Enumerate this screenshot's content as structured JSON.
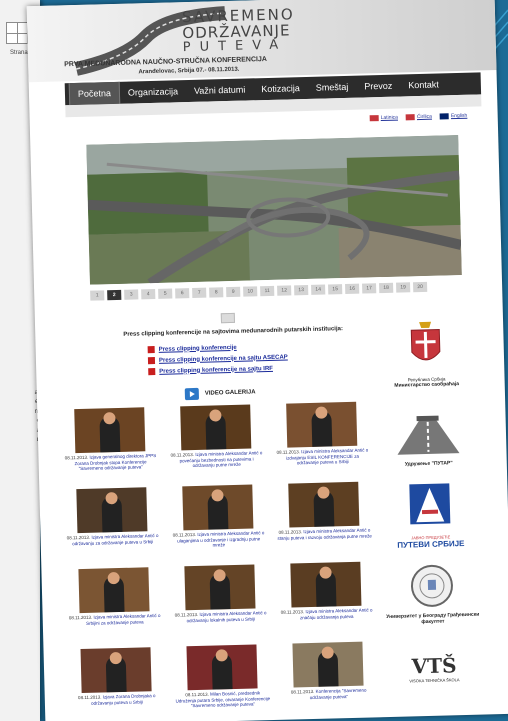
{
  "app": {
    "back_doc_label": "Strana",
    "back_doc_text_lines": [
      "a",
      "i",
      "-",
      "-",
      "g",
      "g",
      "i",
      "a-",
      "e,",
      "n-",
      "e",
      "a",
      "u"
    ]
  },
  "header": {
    "logo_line1": "SAVREMENO",
    "logo_line2": "ODRŽAVANJE",
    "logo_line3": "PUTEVA",
    "conference_title": "PRVA MEĐUNARODNA NAUČNO-STRUČNA KONFERENCIJA",
    "conference_sub": "Aranđelovac, Srbija 07.- 08.11.2013."
  },
  "nav": {
    "items": [
      {
        "label": "Početna",
        "active": true
      },
      {
        "label": "Organizacija",
        "active": false
      },
      {
        "label": "Važni datumi",
        "active": false
      },
      {
        "label": "Kotizacija",
        "active": false
      },
      {
        "label": "Smeštaj",
        "active": false
      },
      {
        "label": "Prevoz",
        "active": false
      },
      {
        "label": "Kontakt",
        "active": false
      }
    ]
  },
  "languages": [
    {
      "label": "Latinica",
      "flag_color": "#c6363c"
    },
    {
      "label": "Ćirilica",
      "flag_color": "#c6363c"
    },
    {
      "label": "English",
      "flag_color": "#012169"
    }
  ],
  "pager": {
    "pages": [
      "1",
      "2",
      "3",
      "4",
      "5",
      "6",
      "7",
      "8",
      "9",
      "10",
      "11",
      "12",
      "13",
      "14",
      "15",
      "16",
      "17",
      "18",
      "19",
      "20"
    ],
    "active_index": 1
  },
  "press": {
    "heading": "Press clipping konferencije na sajtovima medunarodnih putarskih institucija:",
    "items": [
      "Press clipping konferencije",
      "Press clipping konferencije na sajtu ASECAP",
      "Press clipping konferencije na sajtu IRF"
    ]
  },
  "video_gallery": "VIDEO GALERIJA",
  "thumbs": [
    {
      "date": "08.11.2013.",
      "caption": "Izjava generalnog direktora JPPS Zorana Drobnjak stopa Konferencije \"Savremeno održavanje puteva\""
    },
    {
      "date": "08.11.2013.",
      "caption": "Izjava ministra Aleksandar Antić o povećanju bezbednosti na putevima i održavanju putne mreže"
    },
    {
      "date": "08.11.2013.",
      "caption": "Izjava ministra Aleksandar Antić o izdvajanju ESIL KONFERENCIJE za održavanje puteva u Srbiji"
    },
    {
      "date": "08.11.2013.",
      "caption": "Izjava ministra Aleksandar Antić o održavanju za održavanje puteva u Srbiji"
    },
    {
      "date": "08.11.2013.",
      "caption": "Izjava ministra Aleksandar Antić o ulaganjima u održavanje i izgradnju putne mreže"
    },
    {
      "date": "08.11.2013.",
      "caption": "Izjava ministra Aleksandar Antić o stanju puteva i razvoju održavanja putne mreže"
    },
    {
      "date": "08.11.2013.",
      "caption": "Izjava ministra Aleksandar Antić o Srbijini za održavanje puteva"
    },
    {
      "date": "08.11.2013.",
      "caption": "Izjava ministra Aleksandar Antić o održavanju lokalnih puteva u Srbiji"
    },
    {
      "date": "08.11.2013.",
      "caption": "Izjava ministra Aleksandar Antić o značaju održavanja puteva"
    },
    {
      "date": "08.11.2013.",
      "caption": "Izjava Zorana Drobnjaka o održavanju puteva u Srbiji"
    },
    {
      "date": "08.11.2013.",
      "caption": "Milan Bosnić, predsednik Udruženja putara Srbije, otvaranje Konferencije \"Savremeno održavanje puteva\""
    },
    {
      "date": "08.11.2013.",
      "caption": "Konferencija \"Savremeno održavanje puteva\""
    }
  ],
  "sponsors": [
    {
      "caption": "Министарство саобраћаја",
      "sub": "Република Србија"
    },
    {
      "caption": "Удружење \"ПУТАР\"",
      "sub": ""
    },
    {
      "caption": "ПУТЕВИ СРБИЈЕ",
      "sub": "ЈАВНО ПРЕДУЗЕЋЕ"
    },
    {
      "caption": "Универзитет у Београду Грађевински факултет",
      "sub": ""
    },
    {
      "caption": "VTŠ",
      "sub": "VISOKA TEHNIČKA ŠKOLA"
    }
  ],
  "colors": {
    "background": "#1d6b96",
    "nav_bg": "#2c2c2c",
    "link": "#1a2a9a",
    "pdf": "#c81e1e"
  }
}
